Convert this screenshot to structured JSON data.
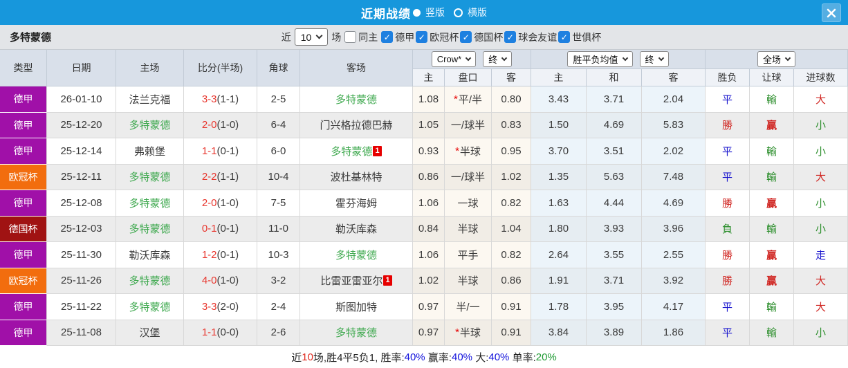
{
  "topbar": {
    "title": "近期战绩",
    "layout_options": [
      {
        "label": "竖版",
        "selected": true
      },
      {
        "label": "横版",
        "selected": false
      }
    ]
  },
  "filterbar": {
    "team": "多特蒙德",
    "near_label": "近",
    "count_value": "10",
    "count_suffix": "场",
    "same_home": {
      "label": "同主",
      "checked": false
    },
    "leagues": [
      {
        "label": "德甲",
        "checked": true
      },
      {
        "label": "欧冠杯",
        "checked": true
      },
      {
        "label": "德国杯",
        "checked": true
      },
      {
        "label": "球会友谊",
        "checked": true
      },
      {
        "label": "世俱杯",
        "checked": true
      }
    ]
  },
  "table": {
    "left_headers": [
      "类型",
      "日期",
      "主场",
      "比分(半场)",
      "角球",
      "客场"
    ],
    "dropdowns": {
      "company": "Crow*",
      "company_time": "终",
      "avg": "胜平负均值",
      "avg_time": "终",
      "scope": "全场"
    },
    "sub_headers": [
      "主",
      "盘口",
      "客",
      "主",
      "和",
      "客",
      "胜负",
      "让球",
      "进球数"
    ],
    "league_colors": {
      "德甲": "#A010A8",
      "欧冠杯": "#F26D0E",
      "德国杯": "#A01313"
    },
    "rows": [
      {
        "league": "德甲",
        "date": "26-01-10",
        "home": "法兰克福",
        "home_dortmund": false,
        "home_card": null,
        "score": "3-3",
        "half": "(1-1)",
        "corners": "2-5",
        "away": "多特蒙德",
        "away_dortmund": true,
        "away_card": null,
        "o_home": "1.08",
        "handicap": "平/半",
        "handicap_star": true,
        "o_away": "0.80",
        "avg_win": "3.43",
        "avg_draw": "3.71",
        "avg_lose": "2.04",
        "r_outcome": "平",
        "r_outcome_c": "blue",
        "r_handicap": "輸",
        "r_handicap_c": "green",
        "r_goals": "大",
        "r_goals_c": "red"
      },
      {
        "league": "德甲",
        "date": "25-12-20",
        "home": "多特蒙德",
        "home_dortmund": true,
        "home_card": null,
        "score": "2-0",
        "half": "(1-0)",
        "corners": "6-4",
        "away": "门兴格拉德巴赫",
        "away_dortmund": false,
        "away_card": null,
        "o_home": "1.05",
        "handicap": "一/球半",
        "handicap_star": false,
        "o_away": "0.83",
        "avg_win": "1.50",
        "avg_draw": "4.69",
        "avg_lose": "5.83",
        "r_outcome": "勝",
        "r_outcome_c": "red",
        "r_handicap": "贏",
        "r_handicap_c": "red",
        "r_goals": "小",
        "r_goals_c": "green"
      },
      {
        "league": "德甲",
        "date": "25-12-14",
        "home": "弗赖堡",
        "home_dortmund": false,
        "home_card": null,
        "score": "1-1",
        "half": "(0-1)",
        "corners": "6-0",
        "away": "多特蒙德",
        "away_dortmund": true,
        "away_card": "1",
        "o_home": "0.93",
        "handicap": "半球",
        "handicap_star": true,
        "o_away": "0.95",
        "avg_win": "3.70",
        "avg_draw": "3.51",
        "avg_lose": "2.02",
        "r_outcome": "平",
        "r_outcome_c": "blue",
        "r_handicap": "輸",
        "r_handicap_c": "green",
        "r_goals": "小",
        "r_goals_c": "green"
      },
      {
        "league": "欧冠杯",
        "date": "25-12-11",
        "home": "多特蒙德",
        "home_dortmund": true,
        "home_card": null,
        "score": "2-2",
        "half": "(1-1)",
        "corners": "10-4",
        "away": "波杜基林特",
        "away_dortmund": false,
        "away_card": null,
        "o_home": "0.86",
        "handicap": "一/球半",
        "handicap_star": false,
        "o_away": "1.02",
        "avg_win": "1.35",
        "avg_draw": "5.63",
        "avg_lose": "7.48",
        "r_outcome": "平",
        "r_outcome_c": "blue",
        "r_handicap": "輸",
        "r_handicap_c": "green",
        "r_goals": "大",
        "r_goals_c": "red"
      },
      {
        "league": "德甲",
        "date": "25-12-08",
        "home": "多特蒙德",
        "home_dortmund": true,
        "home_card": null,
        "score": "2-0",
        "half": "(1-0)",
        "corners": "7-5",
        "away": "霍芬海姆",
        "away_dortmund": false,
        "away_card": null,
        "o_home": "1.06",
        "handicap": "一球",
        "handicap_star": false,
        "o_away": "0.82",
        "avg_win": "1.63",
        "avg_draw": "4.44",
        "avg_lose": "4.69",
        "r_outcome": "勝",
        "r_outcome_c": "red",
        "r_handicap": "贏",
        "r_handicap_c": "red",
        "r_goals": "小",
        "r_goals_c": "green"
      },
      {
        "league": "德国杯",
        "date": "25-12-03",
        "home": "多特蒙德",
        "home_dortmund": true,
        "home_card": null,
        "score": "0-1",
        "half": "(0-1)",
        "corners": "11-0",
        "away": "勒沃库森",
        "away_dortmund": false,
        "away_card": null,
        "o_home": "0.84",
        "handicap": "半球",
        "handicap_star": false,
        "o_away": "1.04",
        "avg_win": "1.80",
        "avg_draw": "3.93",
        "avg_lose": "3.96",
        "r_outcome": "負",
        "r_outcome_c": "green",
        "r_handicap": "輸",
        "r_handicap_c": "green",
        "r_goals": "小",
        "r_goals_c": "green"
      },
      {
        "league": "德甲",
        "date": "25-11-30",
        "home": "勒沃库森",
        "home_dortmund": false,
        "home_card": null,
        "score": "1-2",
        "half": "(0-1)",
        "corners": "10-3",
        "away": "多特蒙德",
        "away_dortmund": true,
        "away_card": null,
        "o_home": "1.06",
        "handicap": "平手",
        "handicap_star": false,
        "o_away": "0.82",
        "avg_win": "2.64",
        "avg_draw": "3.55",
        "avg_lose": "2.55",
        "r_outcome": "勝",
        "r_outcome_c": "red",
        "r_handicap": "贏",
        "r_handicap_c": "red",
        "r_goals": "走",
        "r_goals_c": "blue"
      },
      {
        "league": "欧冠杯",
        "date": "25-11-26",
        "home": "多特蒙德",
        "home_dortmund": true,
        "home_card": null,
        "score": "4-0",
        "half": "(1-0)",
        "corners": "3-2",
        "away": "比雷亚雷亚尔",
        "away_dortmund": false,
        "away_card": "1",
        "o_home": "1.02",
        "handicap": "半球",
        "handicap_star": false,
        "o_away": "0.86",
        "avg_win": "1.91",
        "avg_draw": "3.71",
        "avg_lose": "3.92",
        "r_outcome": "勝",
        "r_outcome_c": "red",
        "r_handicap": "贏",
        "r_handicap_c": "red",
        "r_goals": "大",
        "r_goals_c": "red"
      },
      {
        "league": "德甲",
        "date": "25-11-22",
        "home": "多特蒙德",
        "home_dortmund": true,
        "home_card": null,
        "score": "3-3",
        "half": "(2-0)",
        "corners": "2-4",
        "away": "斯图加特",
        "away_dortmund": false,
        "away_card": null,
        "o_home": "0.97",
        "handicap": "半/一",
        "handicap_star": false,
        "o_away": "0.91",
        "avg_win": "1.78",
        "avg_draw": "3.95",
        "avg_lose": "4.17",
        "r_outcome": "平",
        "r_outcome_c": "blue",
        "r_handicap": "輸",
        "r_handicap_c": "green",
        "r_goals": "大",
        "r_goals_c": "red"
      },
      {
        "league": "德甲",
        "date": "25-11-08",
        "home": "汉堡",
        "home_dortmund": false,
        "home_card": null,
        "score": "1-1",
        "half": "(0-0)",
        "corners": "2-6",
        "away": "多特蒙德",
        "away_dortmund": true,
        "away_card": null,
        "o_home": "0.97",
        "handicap": "半球",
        "handicap_star": true,
        "o_away": "0.91",
        "avg_win": "3.84",
        "avg_draw": "3.89",
        "avg_lose": "1.86",
        "r_outcome": "平",
        "r_outcome_c": "blue",
        "r_handicap": "輸",
        "r_handicap_c": "green",
        "r_goals": "小",
        "r_goals_c": "green"
      }
    ]
  },
  "summary": {
    "segments": [
      {
        "t": "近",
        "c": "dark"
      },
      {
        "t": "10",
        "c": "red"
      },
      {
        "t": "场,胜4平5负1, 胜率:",
        "c": "dark"
      },
      {
        "t": "40%",
        "c": "blue"
      },
      {
        "t": " 赢率:",
        "c": "dark"
      },
      {
        "t": "40%",
        "c": "blue"
      },
      {
        "t": " 大:",
        "c": "dark"
      },
      {
        "t": "40%",
        "c": "blue"
      },
      {
        "t": " 单率:",
        "c": "dark"
      },
      {
        "t": "20%",
        "c": "green"
      }
    ]
  },
  "colors": {
    "dark": "#222222",
    "red": "#E02A1F",
    "blue": "#1414DC",
    "green": "#1E9A32",
    "topbar_blue": "#1797DC",
    "checkbox_blue": "#1E80E0",
    "dortmund_green": "#3FA94F",
    "score_red": "#E8372F",
    "result_blue": "#1A16CE",
    "result_red": "#D02622",
    "result_green": "#2E8F2E"
  }
}
